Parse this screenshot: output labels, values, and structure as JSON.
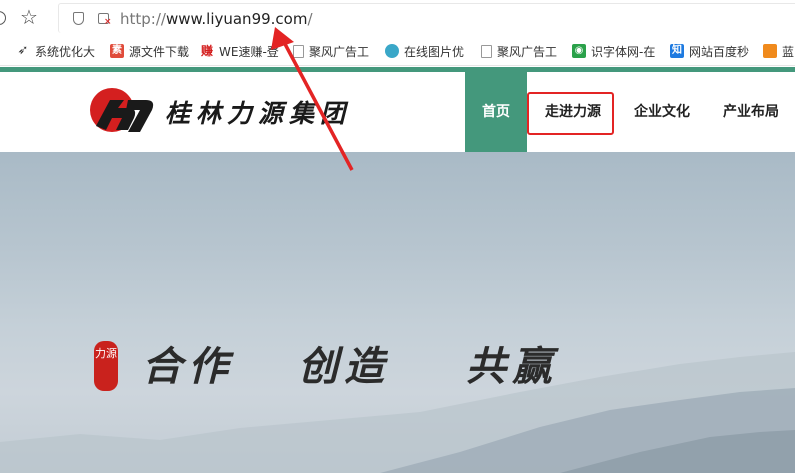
{
  "browser": {
    "url_scheme": "http://",
    "url_host": "www.liyuan99.com",
    "url_path": "/",
    "bookmarks": [
      {
        "label": "系统优化大",
        "icon": "bird-icon",
        "color": "#333333"
      },
      {
        "label": "源文件下载",
        "icon": "su-icon",
        "color": "#e04b3a"
      },
      {
        "label": "WE速赚-登",
        "icon": "zhuan-icon",
        "color": "#d42020"
      },
      {
        "label": "聚风广告工",
        "icon": "page-icon",
        "color": "#ffffff"
      },
      {
        "label": "在线图片优",
        "icon": "cloud-icon",
        "color": "#3aa7c8"
      },
      {
        "label": "聚风广告工",
        "icon": "page-icon",
        "color": "#ffffff"
      },
      {
        "label": "识字体网-在",
        "icon": "eye-icon",
        "color": "#2aa14a"
      },
      {
        "label": "网站百度秒",
        "icon": "zhi-icon",
        "color": "#1e7ae0"
      },
      {
        "label": "蓝",
        "icon": "flag-icon",
        "color": "#f08a1c"
      }
    ]
  },
  "site": {
    "logo_text": "桂林力源集团",
    "nav": {
      "home": "首页",
      "about": "走进力源",
      "culture": "企业文化",
      "layout": "产业布局"
    },
    "accent_color": "#44987c",
    "highlight_color": "#e32424"
  },
  "hero": {
    "seal_text": "力源",
    "slogan_1": "合作",
    "slogan_2": "创造",
    "slogan_3": "共赢"
  }
}
